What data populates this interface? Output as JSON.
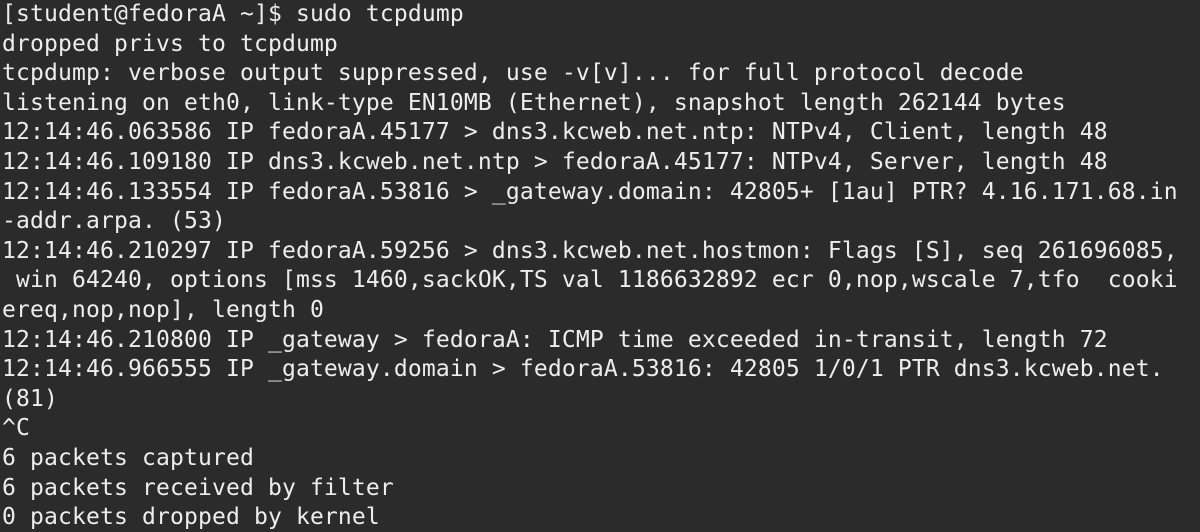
{
  "terminal": {
    "background": "#2b2b2b",
    "foreground": "#ededed",
    "lines": [
      "[student@fedoraA ~]$ sudo tcpdump",
      "dropped privs to tcpdump",
      "tcpdump: verbose output suppressed, use -v[v]... for full protocol decode",
      "listening on eth0, link-type EN10MB (Ethernet), snapshot length 262144 bytes",
      "12:14:46.063586 IP fedoraA.45177 > dns3.kcweb.net.ntp: NTPv4, Client, length 48",
      "12:14:46.109180 IP dns3.kcweb.net.ntp > fedoraA.45177: NTPv4, Server, length 48",
      "12:14:46.133554 IP fedoraA.53816 > _gateway.domain: 42805+ [1au] PTR? 4.16.171.68.in",
      "-addr.arpa. (53)",
      "12:14:46.210297 IP fedoraA.59256 > dns3.kcweb.net.hostmon: Flags [S], seq 261696085,",
      " win 64240, options [mss 1460,sackOK,TS val 1186632892 ecr 0,nop,wscale 7,tfo  cooki",
      "ereq,nop,nop], length 0",
      "12:14:46.210800 IP _gateway > fedoraA: ICMP time exceeded in-transit, length 72",
      "12:14:46.966555 IP _gateway.domain > fedoraA.53816: 42805 1/0/1 PTR dns3.kcweb.net.",
      "(81)",
      "^C",
      "6 packets captured",
      "6 packets received by filter",
      "0 packets dropped by kernel"
    ]
  }
}
